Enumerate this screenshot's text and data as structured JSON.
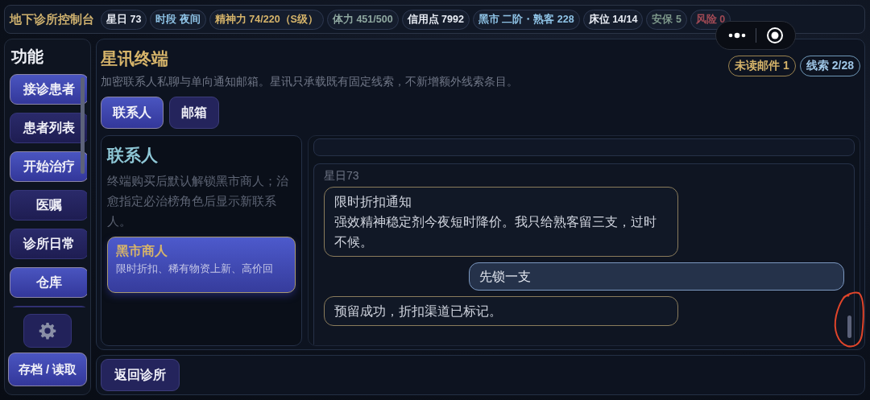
{
  "top_bar": {
    "title": "地下诊所控制台",
    "stats": [
      {
        "text": "星日 73",
        "color": "#e8ecf4"
      },
      {
        "text": "时段 夜间",
        "color": "#8fc3e6"
      },
      {
        "text": "精神力 74/220（S级）",
        "color": "#d6b46a"
      },
      {
        "text": "体力 451/500",
        "color": "#8fa8a0"
      },
      {
        "text": "信用点 7992",
        "color": "#e8ecf4"
      },
      {
        "text": "黑市 二阶・熟客 228",
        "color": "#8fc3e6"
      },
      {
        "text": "床位 14/14",
        "color": "#e8ecf4"
      },
      {
        "text": "安保 5",
        "color": "#7f9a8c"
      },
      {
        "text": "风险 0",
        "color": "#a04a55"
      }
    ]
  },
  "sidebar": {
    "title": "功能",
    "items": [
      {
        "label": "接诊患者",
        "highlighted": true
      },
      {
        "label": "患者列表",
        "highlighted": false
      },
      {
        "label": "开始治疗",
        "highlighted": true
      },
      {
        "label": "医嘱",
        "highlighted": false
      },
      {
        "label": "诊所日常",
        "highlighted": false
      },
      {
        "label": "仓库",
        "highlighted": true
      },
      {
        "highlighted": false
      }
    ],
    "save_button": "存档 / 读取"
  },
  "terminal": {
    "title": "星讯终端",
    "subtitle": "加密联系人私聊与单向通知邮箱。星讯只承载既有固定线索，不新增额外线索条目。",
    "badges": [
      {
        "text": "未读邮件 1",
        "kind": "mail"
      },
      {
        "text": "线索 2/28",
        "kind": "clue"
      }
    ],
    "tabs": [
      {
        "label": "联系人",
        "selected": true
      },
      {
        "label": "邮箱",
        "selected": false
      }
    ],
    "contacts": {
      "title": "联系人",
      "note": "终端购买后默认解锁黑市商人；治愈指定必治榜角色后显示新联系人。",
      "items": [
        {
          "name": "黑市商人",
          "summary": "限时折扣、稀有物资上新、高价回",
          "selected": true
        }
      ]
    },
    "chat": {
      "timestamp": "星日73",
      "messages": [
        {
          "kind": "incoming",
          "title": "限时折扣通知",
          "body": "强效精神稳定剂今夜短时降价。我只给熟客留三支，过时不候。"
        },
        {
          "kind": "outgoing",
          "body": "先锁一支"
        },
        {
          "kind": "incoming",
          "body": "预留成功，折扣渠道已标记。"
        }
      ]
    }
  },
  "bottom_bar": {
    "back_button": "返回诊所"
  }
}
